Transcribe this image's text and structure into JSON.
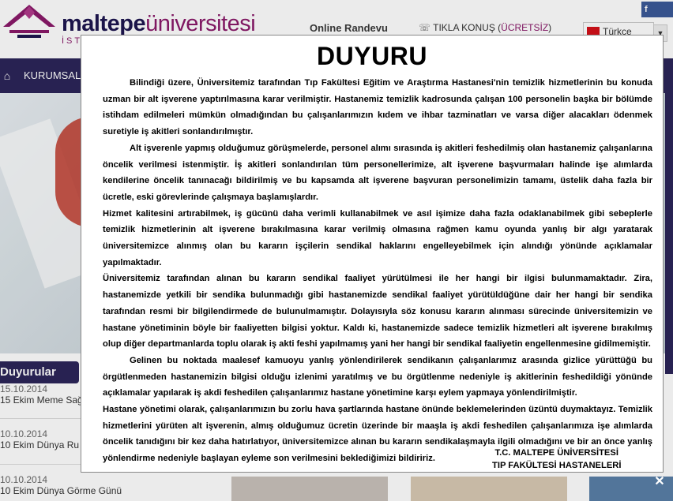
{
  "header": {
    "logo_main": "maltepe",
    "logo_light": "üniversitesi",
    "logo_sub": "İSTANBUL TIP",
    "online_randevu": "Online Randevu",
    "tikla_konus": "TIKLA KONUŞ (",
    "ucretsiz": "ÜCRETSİZ",
    "tikla_close": ")",
    "language": "Türkçe",
    "facebook": "f"
  },
  "nav": {
    "home_icon": "home-icon",
    "kurumsal": "KURUMSAL"
  },
  "announcements": {
    "heading": "Duyurular",
    "items": [
      {
        "date": "15.10.2014",
        "title": "15 Ekim Meme Sağ"
      },
      {
        "date": "10.10.2014",
        "title": "10 Ekim Dünya Ru"
      },
      {
        "date": "10.10.2014",
        "title": "10 Ekim Dünya Görme Günü"
      }
    ]
  },
  "modal": {
    "title": "DUYURU",
    "paragraphs": [
      "Bilindiği üzere, Üniversitemiz tarafından Tıp Fakültesi Eğitim ve Araştırma Hastanesi'nin temizlik hizmetlerinin bu konuda uzman bir alt işverene yaptırılmasına karar verilmiştir. Hastanemiz temizlik kadrosunda çalışan 100 personelin başka bir bölümde istihdam edilmeleri mümkün olmadığından bu çalışanlarımızın kıdem ve ihbar tazminatları ve varsa diğer alacakları ödenmek suretiyle iş akitleri sonlandırılmıştır.",
      "Alt işverenle yapmış olduğumuz görüşmelerde, personel alımı sırasında iş akitleri feshedilmiş olan hastanemiz çalışanlarına öncelik verilmesi istenmiştir. İş akitleri sonlandırılan tüm personellerimize, alt işverene başvurmaları halinde işe alımlarda kendilerine öncelik tanınacağı bildirilmiş ve bu kapsamda alt işverene başvuran personelimizin tamamı, üstelik daha fazla bir ücretle, eski görevlerinde çalışmaya başlamışlardır.",
      "Hizmet kalitesini artırabilmek, iş gücünü daha verimli kullanabilmek ve asıl işimize daha fazla odaklanabilmek gibi sebeplerle temizlik hizmetlerinin alt işverene bırakılmasına karar verilmiş olmasına rağmen kamu oyunda yanlış bir algı yaratarak üniversitemizce alınmış olan bu kararın işçilerin sendikal haklarını engelleyebilmek için alındığı yönünde açıklamalar yapılmaktadır.",
      "Üniversitemiz tarafından alınan bu kararın sendikal faaliyet yürütülmesi ile her hangi bir ilgisi bulunmamaktadır. Zira, hastanemizde yetkili bir sendika bulunmadığı gibi hastanemizde sendikal faaliyet yürütüldüğüne dair her hangi bir sendika tarafından resmi bir bilgilendirmede de bulunulmamıştır. Dolayısıyla söz konusu kararın alınması sürecinde üniversitemizin ve hastane yönetiminin böyle bir faaliyetten bilgisi yoktur. Kaldı ki, hastanemizde sadece temizlik hizmetleri alt işverene bırakılmış olup diğer departmanlarda toplu olarak iş akti feshi yapılmamış yani her hangi bir sendikal faaliyetin engellenmesine gidilmemiştir.",
      "Gelinen bu noktada maalesef kamuoyu yanlış yönlendirilerek sendikanın çalışanlarımız arasında gizlice yürüttüğü bu örgütlenmeden hastanemizin bilgisi olduğu izlenimi yaratılmış ve bu örgütlenme nedeniyle iş akitlerinin feshedildiği yönünde açıklamalar yapılarak iş akdi feshedilen çalışanlarımız hastane yönetimine karşı eylem yapmaya yönlendirilmiştir.",
      "Hastane yönetimi olarak, çalışanlarımızın bu zorlu hava şartlarında hastane önünde beklemelerinden üzüntü duymaktayız. Temizlik hizmetlerini yürüten alt işverenin, almış olduğumuz ücretin üzerinde bir maaşla iş akdi feshedilen çalışanlarımıza işe alımlarda öncelik tanıdığını bir kez daha hatırlatıyor, üniversitemizce alınan bu kararın sendikalaşmayla ilgili olmadığını ve bir an önce yanlış yönlendirme nedeniyle başlayan eyleme son verilmesini beklediğimizi bildiririz."
    ],
    "signature_line1": "T.C. MALTEPE ÜNİVERSİTESİ",
    "signature_line2": "TIP FAKÜLTESİ HASTANELERİ",
    "close_icon": "close-icon"
  }
}
